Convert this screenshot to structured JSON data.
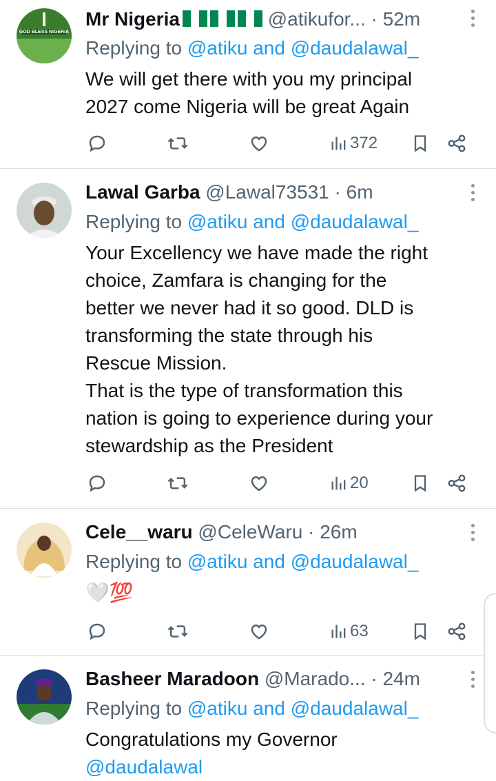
{
  "replying_label": "Replying to",
  "tweets": [
    {
      "name": "Mr Nigeria",
      "handle": "@atikufor...",
      "sep": " · ",
      "time": "52m",
      "reply_to_a": "@atiku",
      "reply_and": " and ",
      "reply_to_b": "@daudalawal_",
      "text": "We will get there with you my principal\n2027 come Nigeria will be great Again",
      "views": "372",
      "avatar_text": "GOD BLESS NIGERIA"
    },
    {
      "name": "Lawal Garba",
      "handle": "@Lawal73531",
      "sep": " · ",
      "time": "6m",
      "reply_to_a": "@atiku",
      "reply_and": " and ",
      "reply_to_b": "@daudalawal_",
      "text": "Your Excellency we have made the right\nchoice, Zamfara is changing for the\nbetter we never had it so good. DLD is\ntransforming the state through his\nRescue Mission.\nThat is the type of transformation this\nnation is going to experience during your\nstewardship as the President",
      "views": "20"
    },
    {
      "name": "Cele__waru",
      "handle": "@CeleWaru",
      "sep": " · ",
      "time": "26m",
      "reply_to_a": "@atiku",
      "reply_and": " and ",
      "reply_to_b": "@daudalawal_",
      "text": "🤍💯",
      "views": "63"
    },
    {
      "name": "Basheer Maradoon",
      "handle": "@Marado...",
      "sep": " · ",
      "time": "24m",
      "reply_to_a": "@atiku",
      "reply_and": " and ",
      "reply_to_b": "@daudalawal_",
      "text": "Congratulations my Governor",
      "mention": "@daudalawal"
    }
  ],
  "colors": {
    "text": "#0f1419",
    "muted": "#536471",
    "link": "#1d9bf0",
    "nigeria_green": "#008751"
  }
}
